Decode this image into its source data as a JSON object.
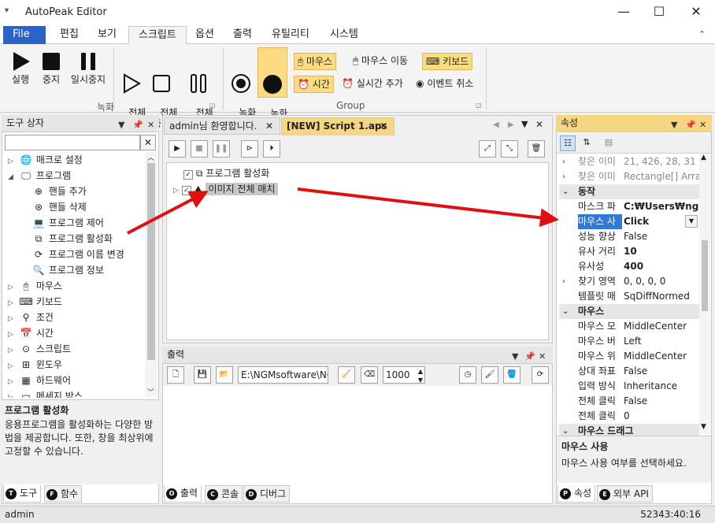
{
  "window": {
    "title": "AutoPeak Editor",
    "quick_access": "▾",
    "minimize": "—",
    "maximize": "☐",
    "close": "✕"
  },
  "ribbon_tabs": [
    {
      "label": "File"
    },
    {
      "label": "편집"
    },
    {
      "label": "보기"
    },
    {
      "label": "스크립트"
    },
    {
      "label": "옵션"
    },
    {
      "label": "출력"
    },
    {
      "label": "유틸리티"
    },
    {
      "label": "시스템"
    }
  ],
  "ribbon": {
    "record_group": {
      "label": "녹화",
      "buttons": [
        {
          "label": "실행"
        },
        {
          "label": "중지"
        },
        {
          "label": "일시중지"
        },
        {
          "label": "전체\n실행"
        },
        {
          "label": "전체\n중지"
        },
        {
          "label": "전체\n일시중지"
        }
      ]
    },
    "group2": {
      "label": "Group",
      "buttons": [
        {
          "label": "녹화\n시작"
        },
        {
          "label": "녹화\n중지"
        }
      ],
      "toggles": [
        {
          "label": "마우스"
        },
        {
          "label": "마우스 이동"
        },
        {
          "label": "키보드"
        },
        {
          "label": "시간"
        },
        {
          "label": "실시간 추가"
        },
        {
          "label": "이벤트 취소"
        }
      ]
    }
  },
  "toolbox": {
    "title": "도구 상자",
    "search_value": "",
    "tree": [
      {
        "label": "매크로 설정"
      },
      {
        "label": "프로그램"
      },
      {
        "label": "핸들 추가"
      },
      {
        "label": "핸들 삭제"
      },
      {
        "label": "프로그램 제어"
      },
      {
        "label": "프로그램 활성화"
      },
      {
        "label": "프로그램 이름 변경"
      },
      {
        "label": "프로그램 정보"
      },
      {
        "label": "마우스"
      },
      {
        "label": "키보드"
      },
      {
        "label": "조건"
      },
      {
        "label": "시간"
      },
      {
        "label": "스크립트"
      },
      {
        "label": "윈도우"
      },
      {
        "label": "하드웨어"
      },
      {
        "label": "메세지 박스"
      }
    ],
    "desc_title": "프로그램 활성화",
    "desc_text": "응용프로그램을 활성화하는 다양한 방법을 제공합니다. 또한, 창을 최상위에 고정할 수 있습니다.",
    "tabs": [
      {
        "label": "도구",
        "key": "T"
      },
      {
        "label": "함수",
        "key": "F"
      }
    ]
  },
  "editor": {
    "tabs": [
      {
        "label": "admin님 환영합니다."
      },
      {
        "label": "[NEW] Script 1.aps"
      }
    ],
    "tree": [
      {
        "label": "프로그램 활성화"
      },
      {
        "label": "이미지 전체 매치"
      }
    ]
  },
  "output": {
    "title": "출력",
    "path": "E:\\NGMsoftware\\NG",
    "count": "1000",
    "tabs": [
      {
        "label": "출력",
        "key": "O"
      },
      {
        "label": "콘솔",
        "key": "C"
      },
      {
        "label": "디버그",
        "key": "D"
      }
    ]
  },
  "properties": {
    "title": "속성",
    "rows": [
      {
        "name": "찾은 이미",
        "value": "21, 426, 28, 31",
        "kind": "grey",
        "expand": true
      },
      {
        "name": "찾은 이미",
        "value": "Rectangle[] Array",
        "kind": "grey",
        "expand": true
      },
      {
        "name": "동작",
        "kind": "cat"
      },
      {
        "name": "마스크 파",
        "value": "C:₩Users₩ngma",
        "bold": true
      },
      {
        "name": "마우스 사",
        "value": "Click",
        "bold": true,
        "selected": true
      },
      {
        "name": "성능 향상",
        "value": "False"
      },
      {
        "name": "유사 거리",
        "value": "10",
        "bold": true
      },
      {
        "name": "유사성",
        "value": "400",
        "bold": true
      },
      {
        "name": "찾기 영역",
        "value": "0, 0, 0, 0",
        "expand": true
      },
      {
        "name": "템플릿 매",
        "value": "SqDiffNormed"
      },
      {
        "name": "마우스",
        "kind": "cat"
      },
      {
        "name": "마우스 모",
        "value": "MiddleCenter"
      },
      {
        "name": "마우스 버",
        "value": "Left"
      },
      {
        "name": "마우스 위",
        "value": "MiddleCenter"
      },
      {
        "name": "상대 좌표",
        "value": "False"
      },
      {
        "name": "입력 방식",
        "value": "Inheritance"
      },
      {
        "name": "전체 클릭",
        "value": "False"
      },
      {
        "name": "전체 클릭",
        "value": "0"
      },
      {
        "name": "마우스 드래그",
        "kind": "cat"
      }
    ],
    "desc_title": "마우스 사용",
    "desc_text": "마우스 사용 여부를 선택하세요.",
    "tabs": [
      {
        "label": "속성",
        "key": "P"
      },
      {
        "label": "외부 API",
        "key": "E"
      }
    ]
  },
  "status": {
    "user": "admin",
    "time": "52343:40:16"
  },
  "colors": {
    "accent": "#2b63c6",
    "selection": "#3278d7",
    "highlight": "#fcdc82",
    "arrow": "#e01010"
  }
}
